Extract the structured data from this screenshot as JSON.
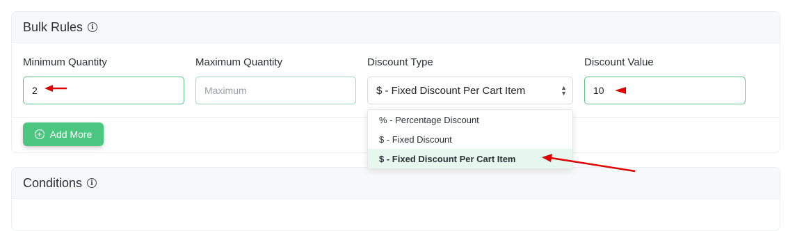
{
  "bulk_rules": {
    "title": "Bulk Rules",
    "min_qty": {
      "label": "Minimum Quantity",
      "value": "2"
    },
    "max_qty": {
      "label": "Maximum Quantity",
      "placeholder": "Maximum"
    },
    "discount_type": {
      "label": "Discount Type",
      "selected": "$ - Fixed Discount Per Cart Item",
      "options": [
        "% - Percentage Discount",
        "$ - Fixed Discount",
        "$ - Fixed Discount Per Cart Item"
      ]
    },
    "discount_value": {
      "label": "Discount Value",
      "value": "10"
    },
    "add_more_label": "Add More"
  },
  "conditions": {
    "title": "Conditions"
  },
  "icons": {
    "info": "info-circle-icon",
    "plus": "plus-circle-icon",
    "chevron": "chevron-up-down-icon"
  },
  "colors": {
    "accent": "#4cc782",
    "annotation": "#e00000",
    "selected_bg": "#e6f7ee"
  }
}
